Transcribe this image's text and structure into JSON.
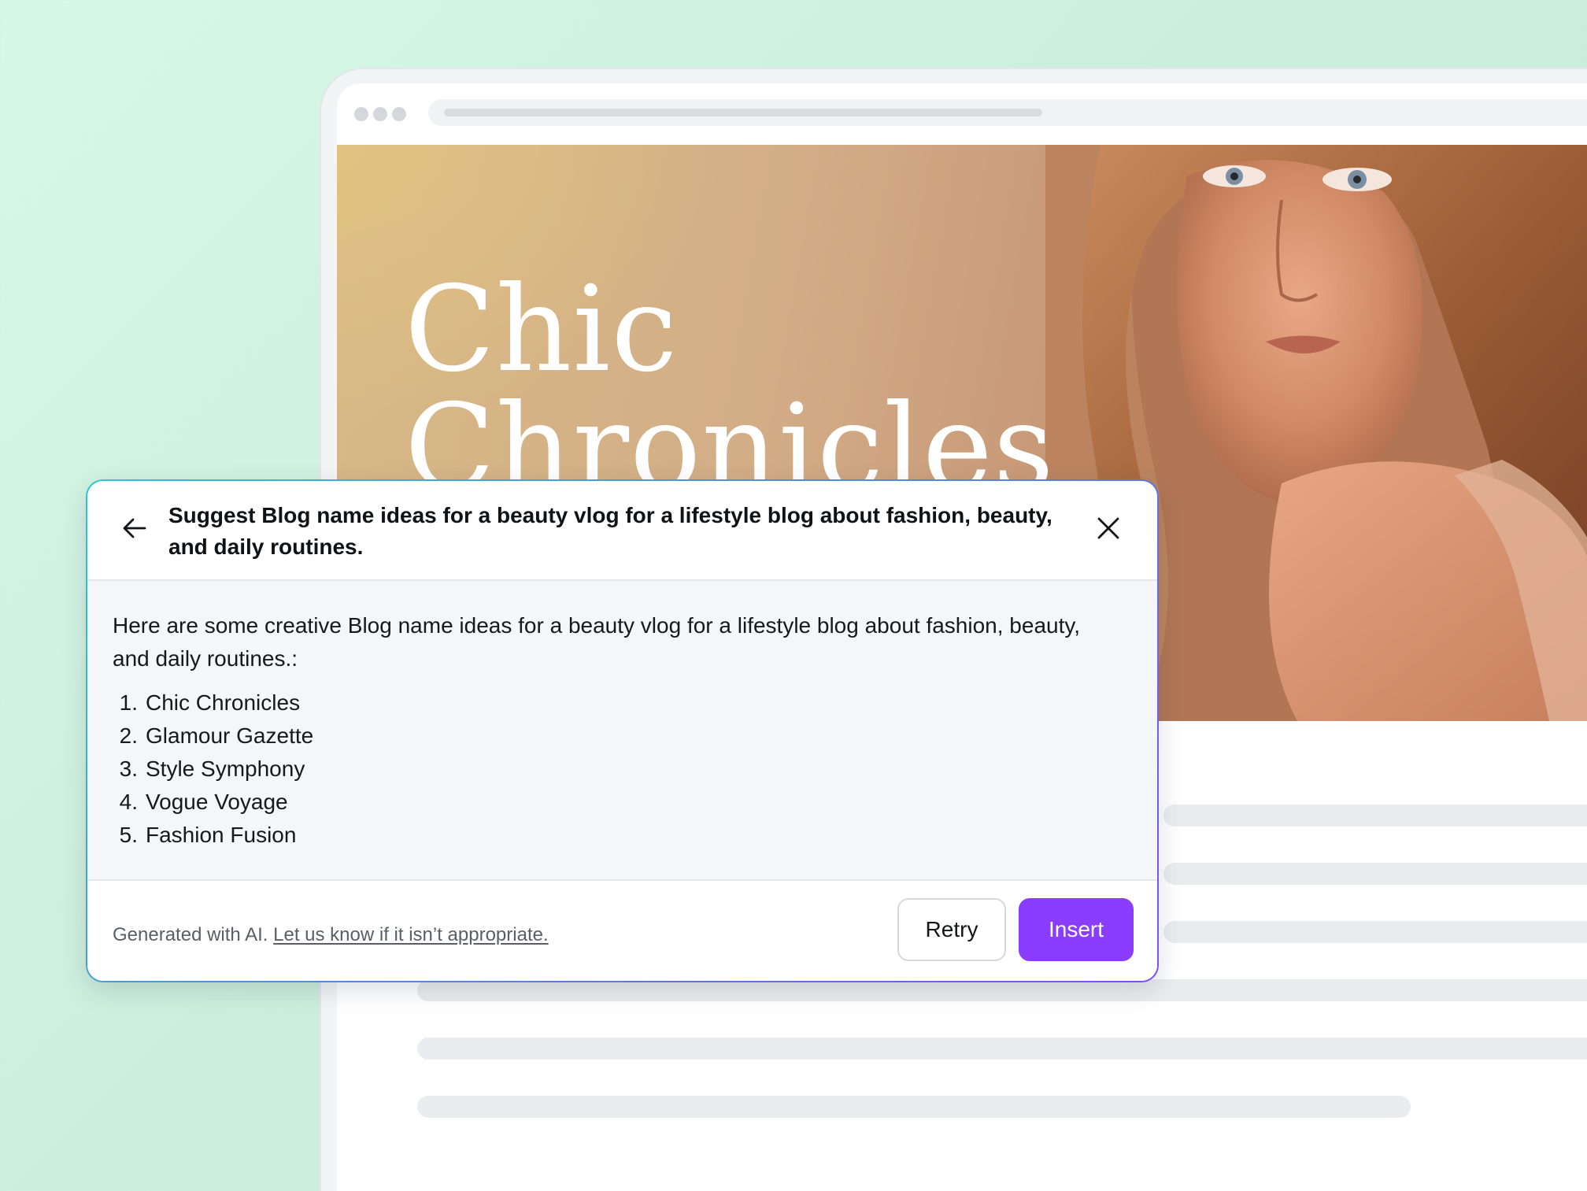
{
  "hero": {
    "title_line1": "Chic",
    "title_line2": "Chronicles"
  },
  "ai_panel": {
    "prompt": "Suggest Blog name ideas for a beauty vlog for a lifestyle blog about fashion, beauty, and daily routines.",
    "intro": "Here are some creative Blog name ideas for a beauty vlog for a lifestyle blog about fashion, beauty, and daily routines.:",
    "ideas": [
      {
        "num": "1.",
        "text": "Chic Chronicles"
      },
      {
        "num": "2.",
        "text": "Glamour Gazette"
      },
      {
        "num": "3.",
        "text": "Style Symphony"
      },
      {
        "num": "4.",
        "text": "Vogue Voyage"
      },
      {
        "num": "5.",
        "text": "Fashion Fusion"
      }
    ],
    "footer": {
      "disclaimer": "Generated with AI.",
      "feedback_link": "Let us know if it isn’t appropriate.",
      "retry_label": "Retry",
      "insert_label": "Insert"
    }
  },
  "icons": {
    "back": "arrow-left-icon",
    "close": "close-icon"
  },
  "colors": {
    "accent": "#8b3dff",
    "background": "#d4f4e3"
  }
}
